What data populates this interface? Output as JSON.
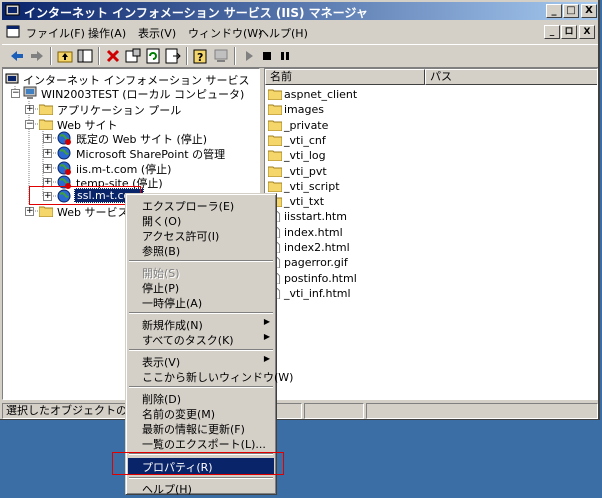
{
  "window": {
    "title": "インターネット インフォメーション サービス (IIS) マネージャ",
    "caption_buttons": [
      "_",
      "□",
      "X"
    ]
  },
  "menubar": {
    "items": [
      "ファイル(F)",
      "操作(A)",
      "表示(V)",
      "ウィンドウ(W)",
      "ヘルプ(H)"
    ],
    "mdi_buttons": [
      "_",
      "ロ",
      "X"
    ]
  },
  "tree": {
    "root": "インターネット インフォメーション サービス",
    "computer": "WIN2003TEST (ローカル コンピュータ)",
    "app_pools": "アプリケーション プール",
    "websites": "Web サイト",
    "default_site": "既定の Web サイト (停止)",
    "sharepoint": "Microsoft SharePoint の管理",
    "iis_site": "iis.m-t.com (停止)",
    "temp_site": "temp-site (停止)",
    "ssl_site": "ssl.m-t.com",
    "web_ext": "Web サービス拡"
  },
  "list": {
    "headers": [
      "名前",
      "パス"
    ],
    "items": [
      {
        "name": "aspnet_client",
        "icon": "folder"
      },
      {
        "name": "images",
        "icon": "folder"
      },
      {
        "name": "_private",
        "icon": "folder"
      },
      {
        "name": "_vti_cnf",
        "icon": "folder"
      },
      {
        "name": "_vti_log",
        "icon": "folder"
      },
      {
        "name": "_vti_pvt",
        "icon": "folder"
      },
      {
        "name": "_vti_script",
        "icon": "folder"
      },
      {
        "name": "_vti_txt",
        "icon": "folder"
      },
      {
        "name": "iisstart.htm",
        "icon": "file"
      },
      {
        "name": "index.html",
        "icon": "file"
      },
      {
        "name": "index2.html",
        "icon": "file"
      },
      {
        "name": "pagerror.gif",
        "icon": "file"
      },
      {
        "name": "postinfo.html",
        "icon": "file"
      },
      {
        "name": "_vti_inf.html",
        "icon": "file"
      }
    ]
  },
  "statusbar": {
    "text": "選択したオブジェクトのプロパ"
  },
  "context_menu": {
    "explorer": "エクスプローラ(E)",
    "open": "開く(O)",
    "permissions": "アクセス許可(I)",
    "browse": "参照(B)",
    "start": "開始(S)",
    "stop": "停止(P)",
    "pause": "一時停止(A)",
    "new": "新規作成(N)",
    "all_tasks": "すべてのタスク(K)",
    "view": "表示(V)",
    "new_window": "ここから新しいウィンドウ(W)",
    "delete": "削除(D)",
    "rename": "名前の変更(M)",
    "refresh": "最新の情報に更新(F)",
    "export": "一覧のエクスポート(L)...",
    "properties": "プロパティ(R)",
    "help": "ヘルプ(H)",
    "submenu_arrow": "▶"
  },
  "colors": {
    "desktop": "#3a6ea5",
    "title_start": "#0a246a",
    "title_end": "#a6caf0",
    "face": "#d4d0c8",
    "highlight_box": "#e00000",
    "folder": "#f5d66b"
  }
}
